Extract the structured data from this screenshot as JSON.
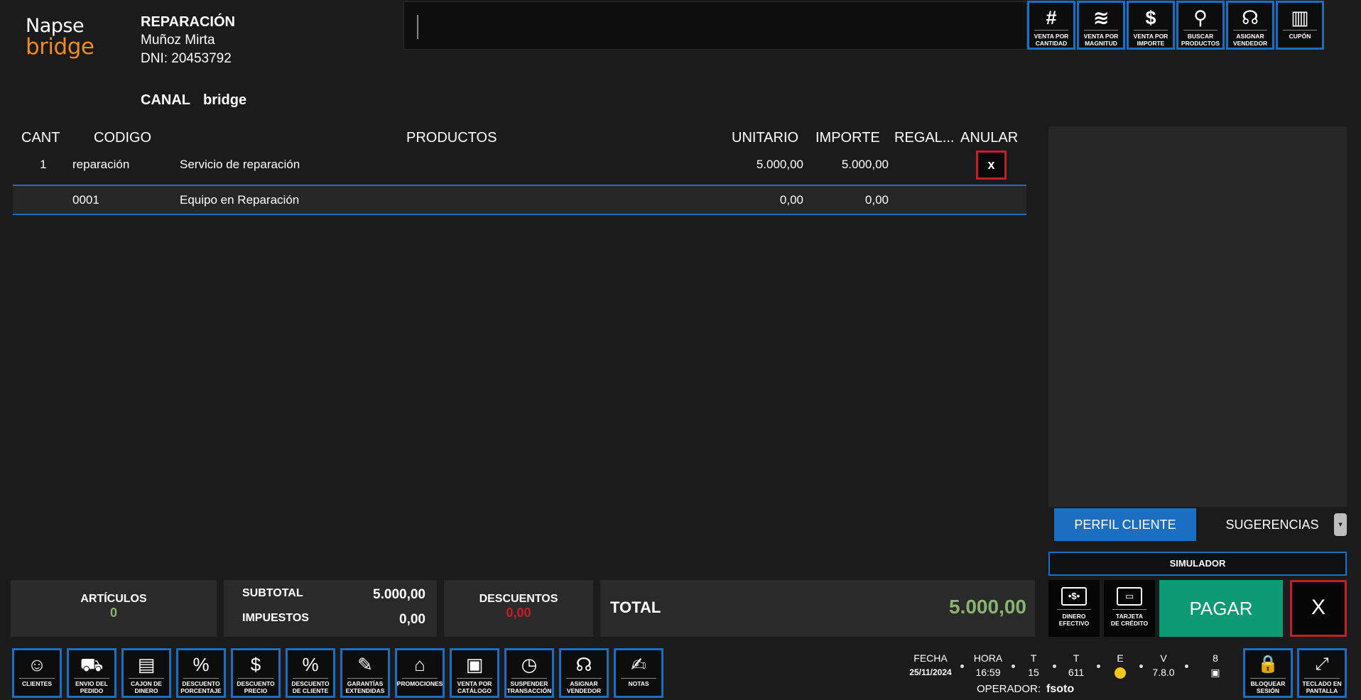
{
  "logo": {
    "line1": "Napse",
    "line2": "bridge"
  },
  "customer": {
    "title": "REPARACIÓN",
    "name": "Muñoz Mirta",
    "dni": "DNI: 20453792"
  },
  "canal": {
    "label": "CANAL",
    "value": "bridge"
  },
  "scan_input": {
    "value": ""
  },
  "top_buttons": [
    {
      "icon": "#",
      "label": "VENTA POR\nCANTIDAD"
    },
    {
      "icon": "≋",
      "label": "VENTA POR\nMAGNITUD"
    },
    {
      "icon": "$",
      "label": "VENTA POR\nIMPORTE"
    },
    {
      "icon": "⚲",
      "label": "BUSCAR\nPRODUCTOS"
    },
    {
      "icon": "☊",
      "label": "ASIGNAR\nVENDEDOR"
    },
    {
      "icon": "▥",
      "label": "CUPÓN"
    }
  ],
  "table": {
    "headers": {
      "cant": "CANT",
      "codigo": "CODIGO",
      "productos": "PRODUCTOS",
      "unitario": "UNITARIO",
      "importe": "IMPORTE",
      "regalo": "REGAL...",
      "anular": "ANULAR"
    },
    "rows": [
      {
        "cant": "1",
        "codigo": "reparación",
        "producto": "Servicio de reparación",
        "unitario": "5.000,00",
        "importe": "5.000,00",
        "anular": "x"
      },
      {
        "cant": "",
        "codigo": "0001",
        "producto": "Equipo en Reparación",
        "unitario": "0,00",
        "importe": "0,00"
      }
    ]
  },
  "right_panel": {
    "tab_active": "PERFIL CLIENTE",
    "tab_other": "SUGERENCIAS",
    "dropdown_icon": "▾"
  },
  "simulador": "SIMULADOR",
  "summary": {
    "articulos_label": "ARTÍCULOS",
    "articulos_value": "0",
    "subtotal_label": "SUBTOTAL",
    "subtotal_value": "5.000,00",
    "impuestos_label": "IMPUESTOS",
    "impuestos_value": "0,00",
    "descuentos_label": "DESCUENTOS",
    "descuentos_value": "0,00",
    "total_label": "TOTAL",
    "total_value": "5.000,00"
  },
  "pay": {
    "efectivo": {
      "icon": "•$•",
      "label": "DINERO\nEFECTIVO"
    },
    "tarjeta": {
      "icon": "▭",
      "label": "TARJETA\nDE CRÉDITO"
    },
    "pagar": "PAGAR",
    "cancel": "X"
  },
  "bottom_buttons": [
    {
      "icon": "☺",
      "label": "CLIENTES"
    },
    {
      "icon": "⛟",
      "label": "ENVIO DEL\nPEDIDO"
    },
    {
      "icon": "▤",
      "label": "CAJON DE\nDINERO"
    },
    {
      "icon": "%",
      "label": "DESCUENTO\nPORCENTAJE"
    },
    {
      "icon": "$",
      "label": "DESCUENTO\nPRECIO"
    },
    {
      "icon": "%",
      "label": "DESCUENTO\nDE CLIENTE"
    },
    {
      "icon": "✎",
      "label": "GARANTÍAS\nEXTENDIDAS"
    },
    {
      "icon": "⌂",
      "label": "PROMOCIONES"
    },
    {
      "icon": "▣",
      "label": "VENTA POR\nCATÁLOGO"
    },
    {
      "icon": "◷",
      "label": "SUSPENDER\nTRANSACCIÓN"
    },
    {
      "icon": "☊",
      "label": "ASIGNAR\nVENDEDOR"
    },
    {
      "icon": "✍",
      "label": "NOTAS"
    }
  ],
  "status": {
    "fecha_label": "FECHA",
    "fecha_value": "25/11/2024",
    "hora_label": "HORA",
    "hora_value": "16:59",
    "t1_label": "T",
    "t1_value": "15",
    "t2_label": "T",
    "t2_value": "611",
    "e_label": "E",
    "v_label": "V",
    "v_value": "7.8.0",
    "n_label": "8",
    "operador_label": "OPERADOR:",
    "operador_value": "fsoto"
  },
  "right_buttons": [
    {
      "icon": "🔒",
      "label": "BLOQUEAR\nSESIÓN"
    },
    {
      "icon": "⤢",
      "label": "TECLADO EN\nPANTALLA"
    }
  ]
}
